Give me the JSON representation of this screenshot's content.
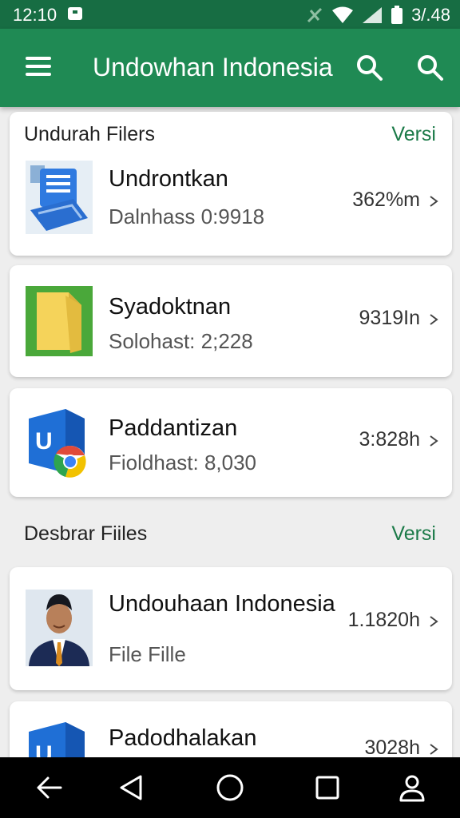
{
  "status_bar": {
    "time": "12:10",
    "battery_text": "3/.48",
    "icons": [
      "notification-icon",
      "no-signal-icon",
      "wifi-icon",
      "cell-signal-icon",
      "battery-icon"
    ]
  },
  "app_bar": {
    "title": "Undowhan Indonesia",
    "icons": [
      "menu-icon",
      "search-icon",
      "search-icon"
    ]
  },
  "sections": [
    {
      "title": "Undurah Filers",
      "action": "Versi",
      "files": [
        {
          "name": "Undrontkan",
          "subtitle": "Dalnhass 0:9918",
          "size": "362%m",
          "thumbnail": "document-app-icon"
        },
        {
          "name": "Syadoktnan",
          "subtitle": "Solohast: 2;228",
          "size": "9319In",
          "thumbnail": "folder-icon"
        },
        {
          "name": "Paddantizan",
          "subtitle": "Fioldhast: 8,030",
          "size": "3:828h",
          "thumbnail": "outlook-chrome-icon"
        }
      ]
    },
    {
      "title": "Desbrar Fiiles",
      "action": "Versi",
      "files": [
        {
          "name": "Undouhaan Indonesia",
          "subtitle": "File Fille",
          "size": "1.1820h",
          "thumbnail": "person-photo"
        },
        {
          "name": "Padodhalakan",
          "subtitle": "",
          "size": "3028h",
          "thumbnail": "outlook-chrome-icon"
        }
      ]
    }
  ],
  "nav_bar": {
    "icons": [
      "back-arrow-icon",
      "back-triangle-icon",
      "home-circle-icon",
      "recents-square-icon",
      "profile-icon"
    ]
  },
  "colors": {
    "status_bar": "#176d43",
    "app_bar": "#1f8a54",
    "accent_text": "#1b7a48",
    "background": "#eeeeee"
  }
}
